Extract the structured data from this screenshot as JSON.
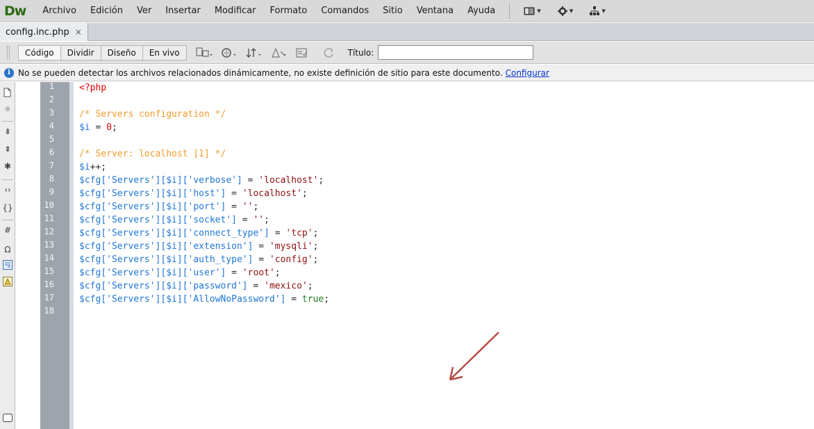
{
  "app": {
    "logo": "Dw"
  },
  "menu": [
    "Archivo",
    "Edición",
    "Ver",
    "Insertar",
    "Modificar",
    "Formato",
    "Comandos",
    "Sitio",
    "Ventana",
    "Ayuda"
  ],
  "menu_icons": [
    "layout-switcher-icon",
    "gear-icon",
    "site-icon"
  ],
  "tab": {
    "filename": "config.inc.php",
    "close": "×"
  },
  "views": [
    "Código",
    "Dividir",
    "Diseño",
    "En vivo"
  ],
  "toolbar": {
    "title_label": "Título:",
    "title_value": ""
  },
  "info": {
    "message": "No se pueden detectar los archivos relacionados dinámicamente, no existe definición de sitio para este documento.",
    "link": "Configurar"
  },
  "line_numbers": [
    "1",
    "2",
    "3",
    "4",
    "5",
    "6",
    "7",
    "8",
    "9",
    "10",
    "11",
    "12",
    "13",
    "14",
    "15",
    "16",
    "17",
    "18"
  ],
  "code": {
    "l1": "<?php",
    "l3": "/* Servers configuration */",
    "l4a": "$i",
    "l4b": " = ",
    "l4c": "0",
    "l4d": ";",
    "l6": "/* Server: localhost [1] */",
    "l7a": "$i",
    "l7b": "++;",
    "rows": [
      {
        "prefix": "$cfg['Servers'][$i]['verbose']",
        "value": "'localhost'"
      },
      {
        "prefix": "$cfg['Servers'][$i]['host']",
        "value": "'localhost'"
      },
      {
        "prefix": "$cfg['Servers'][$i]['port']",
        "value": "''"
      },
      {
        "prefix": "$cfg['Servers'][$i]['socket']",
        "value": "''"
      },
      {
        "prefix": "$cfg['Servers'][$i]['connect_type']",
        "value": "'tcp'"
      },
      {
        "prefix": "$cfg['Servers'][$i]['extension']",
        "value": "'mysqli'"
      },
      {
        "prefix": "$cfg['Servers'][$i]['auth_type']",
        "value": "'config'"
      },
      {
        "prefix": "$cfg['Servers'][$i]['user']",
        "value": "'root'"
      },
      {
        "prefix": "$cfg['Servers'][$i]['password']",
        "value": "'mexico'"
      },
      {
        "prefix": "$cfg['Servers'][$i]['AllowNoPassword']",
        "value": "true"
      }
    ],
    "assign": " = ",
    "semicolon": ";"
  },
  "colors": {
    "tag": "#e00000",
    "comment": "#f09a2b",
    "variable": "#1f76d6",
    "string": "#8e1010",
    "keyword": "#207a20",
    "arrow": "#b24b45"
  }
}
